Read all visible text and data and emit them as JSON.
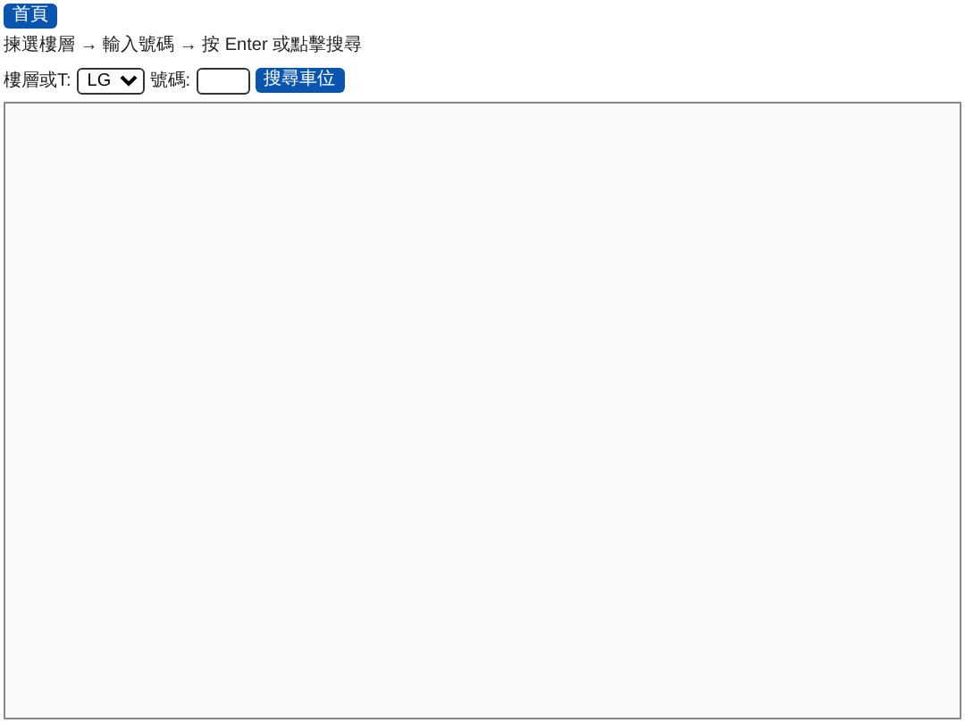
{
  "home_button": "首頁",
  "instructions": "揀選樓層 → 輸入號碼 → 按 Enter 或點擊搜尋",
  "search": {
    "floor_label": "樓層或T:",
    "floor_value": "LG",
    "number_label": "號碼:",
    "button": "搜尋車位"
  }
}
